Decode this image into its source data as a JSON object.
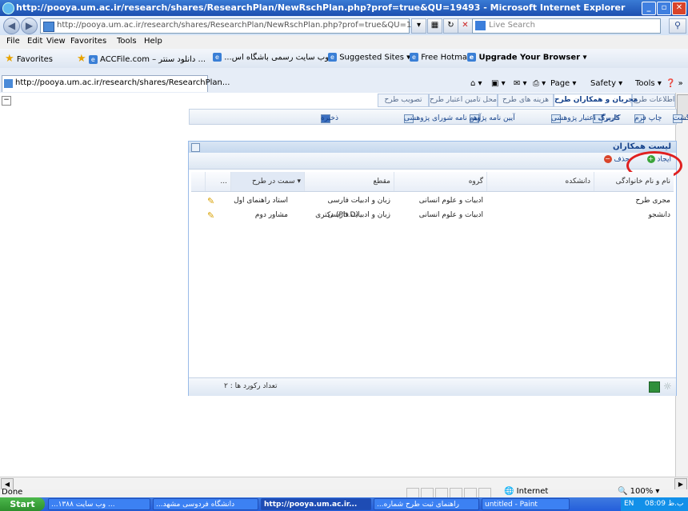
{
  "window": {
    "title": "http://pooya.um.ac.ir/research/shares/ResearchPlan/NewRschPlan.php?prof=true&QU=19493 - Microsoft Internet Explorer",
    "min": "_",
    "max": "▫",
    "close": "✕"
  },
  "address": {
    "url": "http://pooya.um.ac.ir/research/shares/ResearchPlan/NewRschPlan.php?prof=true&QU=19493",
    "search_placeholder": "Live Search"
  },
  "menu": [
    "File",
    "Edit",
    "View",
    "Favorites",
    "Tools",
    "Help"
  ],
  "favorites": {
    "label": "Favorites",
    "items": [
      "ACCFile.com – دانلود سنتر ...",
      "...وب سایت رسمی باشگاه اس",
      "Suggested Sites ▾",
      "Free Hotmail",
      "Upgrade Your Browser ▾"
    ]
  },
  "tab": {
    "title": "http://pooya.um.ac.ir/research/shares/ResearchPlan..."
  },
  "commandbar": [
    "Page ▾",
    "Safety ▾",
    "Tools ▾"
  ],
  "app_tabs": [
    "اطلاعات طرح",
    "مجریان و همکاران طرح",
    "هزینه های طرح",
    "محل تامین اعتبار طرح",
    "تصویب طرح"
  ],
  "app_toolbar": [
    "بازگشت",
    "چاپ فرم",
    "کاربرگ ۱",
    "کاربرگ اعتبار پژوهشی",
    "آیین نامه پژوهه",
    "آیین نامه شورای پژوهشی",
    "ذخیره"
  ],
  "panel": {
    "title": "لیست همکاران",
    "create_label": "ایجاد",
    "delete_label": "حذف",
    "columns": [
      "نام و نام خانوادگی",
      "دانشکده",
      "گروه",
      "مقطع",
      "سمت در طرح ▾",
      "..."
    ],
    "rows": [
      [
        "مجری طرح",
        "",
        "ادبیات و علوم انسانی",
        "زبان و ادبیات فارسی",
        "-",
        "استاد راهنمای اول"
      ],
      [
        "دانشجو",
        "",
        "ادبیات و علوم انسانی",
        "زبان و ادبیات فارسی",
        "دکتری (Ph.D)",
        "مشاور دوم"
      ]
    ],
    "record_count": "تعداد رکورد ها : ۲"
  },
  "status": {
    "done": "Done",
    "zone": "Internet",
    "zoom": "100%"
  },
  "taskbar": {
    "start": "Start",
    "tasks": [
      "...وب سایت ۱۳۸۸ ...",
      "...دانشگاه فردوسی مشهد",
      "http://pooya.um.ac.ir...",
      "...راهنمای ثبت طرح شماره",
      "untitled - Paint"
    ],
    "lang": "EN",
    "time": "08:09 ب.ظ"
  },
  "colors": {
    "accent": "#15428b",
    "highlight_circle": "#e02020",
    "title_bar": "#2a63c8"
  }
}
